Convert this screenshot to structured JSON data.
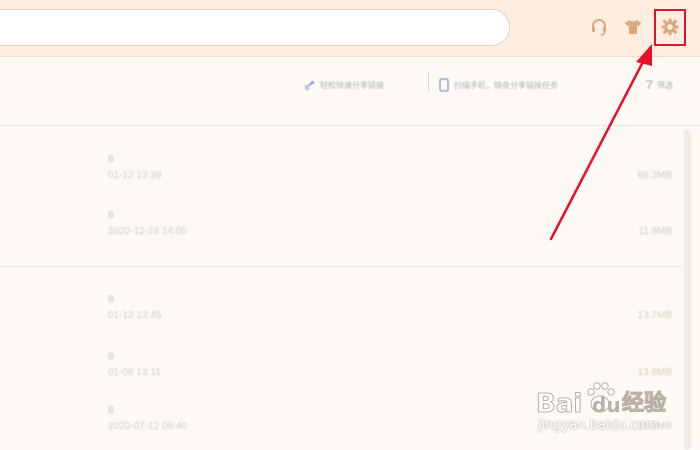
{
  "topbar": {
    "search_placeholder": "",
    "icons": [
      "headset-icon",
      "tshirt-icon",
      "gear-icon"
    ]
  },
  "subbar": {
    "item1": "轻松快速分享链接",
    "item2": "扫描手机，随身分享链接任务",
    "item3": "筛选"
  },
  "groups": [
    {
      "rows": [
        {
          "name": "B",
          "time": "01-12 13:39",
          "size": "66.2MB"
        },
        {
          "name": "B",
          "time": "2020-12-28 14:05",
          "size": "11.8MB"
        }
      ]
    },
    {
      "rows": [
        {
          "name": "B",
          "time": "01-12 13:45",
          "size": "13.7MB"
        },
        {
          "name": "B",
          "time": "01-08 13:11",
          "size": "13.8MB"
        },
        {
          "name": "B",
          "time": "2020-07-12 08:40",
          "size": "13.0MB"
        }
      ]
    }
  ],
  "annotation": {
    "color": "#e8102a"
  },
  "watermark": {
    "logo_text": "Bai du 经验",
    "url": "jingyan.baidu.com"
  }
}
